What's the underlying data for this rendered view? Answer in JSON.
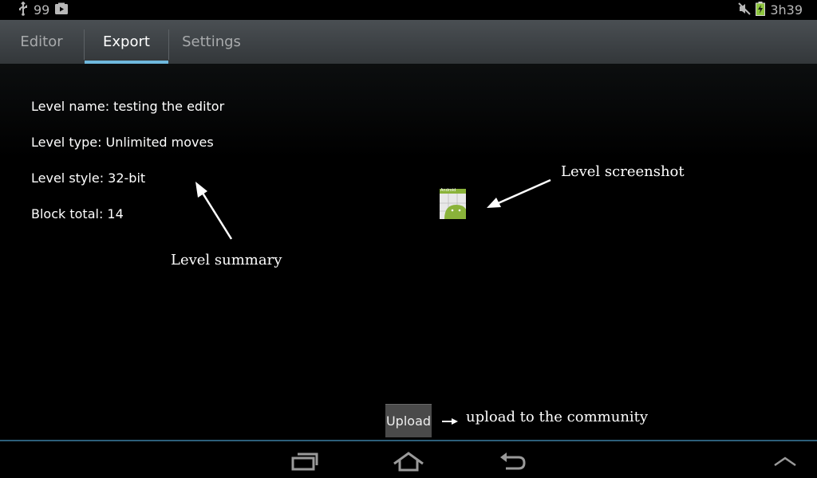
{
  "status_bar": {
    "notification_count": "99",
    "time": "3h39",
    "icons": [
      "usb-icon",
      "media-icon",
      "mute-icon",
      "battery-charging-icon"
    ]
  },
  "tabs": [
    {
      "label": "Editor",
      "selected": false
    },
    {
      "label": "Export",
      "selected": true
    },
    {
      "label": "Settings",
      "selected": false
    }
  ],
  "level_summary": {
    "name_line": "Level name: testing the editor",
    "type_line": "Level type: Unlimited moves",
    "style_line": "Level style: 32-bit",
    "block_line": "Block total: 14"
  },
  "annotations": {
    "summary": "Level summary",
    "screenshot": "Level screenshot",
    "upload": "upload to the community"
  },
  "thumbnail_label": "Android",
  "upload_button": "Upload",
  "nav_bar": {
    "icons": [
      "recent-apps-icon",
      "home-icon",
      "back-icon",
      "menu-up-icon"
    ]
  },
  "colors": {
    "tab_indicator": "#6fb8dd",
    "action_bar": "#3f4447",
    "nav_divider": "#2d5f7a"
  }
}
